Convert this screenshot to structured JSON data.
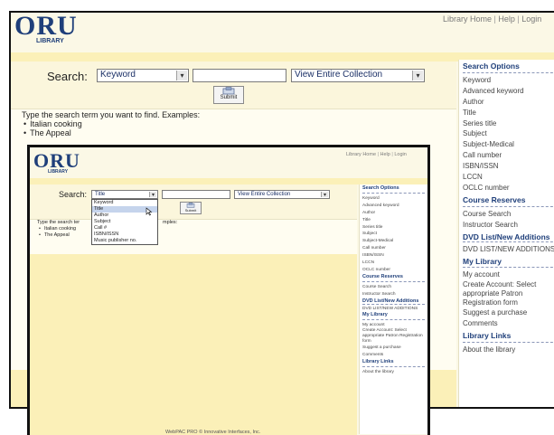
{
  "logo": {
    "text": "ORU",
    "sub": "LIBRARY"
  },
  "toplinks": [
    "Library Home",
    "Help",
    "Login"
  ],
  "search": {
    "label": "Search:",
    "type_value": "Keyword",
    "collection_value": "View Entire Collection",
    "submit_label": "Submit"
  },
  "hint": {
    "text": "Type the search term you want to find. Examples:",
    "examples": [
      "Italian cooking",
      "The Appeal"
    ]
  },
  "sidebar": {
    "search_options": {
      "heading": "Search Options",
      "items": [
        "Keyword",
        "Advanced keyword",
        "Author",
        "Title",
        "Series title",
        "Subject",
        "Subject-Medical",
        "Call number",
        "ISBN/ISSN",
        "LCCN",
        "OCLC number"
      ]
    },
    "course_reserves": {
      "heading": "Course Reserves",
      "items": [
        "Course Search",
        "Instructor Search"
      ]
    },
    "dvd": {
      "heading": "DVD List/New Additions",
      "items": [
        "DVD LIST/NEW ADDITIONS"
      ]
    },
    "my_library": {
      "heading": "My Library",
      "items": [
        "My account",
        "Create Account: Select appropriate Patron Registration form",
        "Suggest a purchase",
        "Comments"
      ]
    },
    "library_links": {
      "heading": "Library Links",
      "items": [
        "About the library"
      ]
    }
  },
  "small": {
    "type_value": "Title",
    "hint_text_visible": "Type the search ter",
    "hint_text_tail": "mples:",
    "example_1_visible": "Italian cooking",
    "dropdown_options": [
      "Keyword",
      "Title",
      "Author",
      "Subject",
      "Call #",
      "ISBN/ISSN",
      "Music publisher no."
    ],
    "footer": "WebPAC PRO © Innovative Interfaces, Inc."
  }
}
